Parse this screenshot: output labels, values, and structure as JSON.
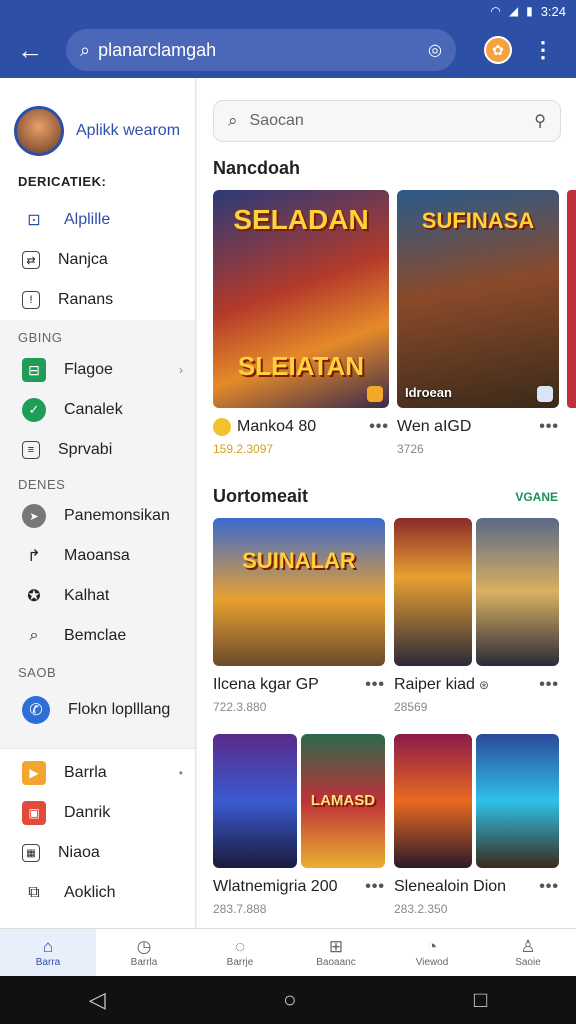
{
  "status_bar": {
    "time": "3:24",
    "wifi_icon": "wifi-icon",
    "signal_icon": "signal-icon",
    "battery_icon": "battery-icon"
  },
  "app_bar": {
    "search_text": "planarclamgah",
    "back_icon": "back-arrow-icon",
    "lens_icon": "lens-icon",
    "more_icon": "more-vert-icon"
  },
  "sidebar": {
    "profile_name": "Aplikk wearom",
    "section1": "DERICATIEK:",
    "items1": [
      {
        "label": "Alplille",
        "icon": "bag-icon"
      },
      {
        "label": "Nanjca",
        "icon": "doc-icon"
      },
      {
        "label": "Ranans",
        "icon": "info-icon"
      }
    ],
    "section2": "GBING",
    "items2": [
      {
        "label": "Flagoe",
        "icon": "grid-icon"
      },
      {
        "label": "Canalek",
        "icon": "compass-icon"
      },
      {
        "label": "Sprvabi",
        "icon": "list-icon"
      }
    ],
    "section3": "DENES",
    "items3": [
      {
        "label": "Panemonsikan",
        "icon": "send-icon"
      },
      {
        "label": "Maoansa",
        "icon": "share-icon"
      },
      {
        "label": "Kalhat",
        "icon": "badge-icon"
      },
      {
        "label": "Bemclae",
        "icon": "search-icon"
      }
    ],
    "section4": "SAOB",
    "special_item": {
      "label": "Flokn loplllang",
      "icon": "blue-circle-icon"
    },
    "items5": [
      {
        "label": "Barrla",
        "icon": "play-store-icon"
      },
      {
        "label": "Danrik",
        "icon": "gift-icon"
      },
      {
        "label": "Niaoa",
        "icon": "calc-icon"
      },
      {
        "label": "Aoklich",
        "icon": "open-icon"
      }
    ]
  },
  "content": {
    "search_placeholder": "Saocan",
    "section_a": "Nancdoah",
    "section_b": "Uortomeait",
    "section_b_link": "VGANE",
    "featured": [
      {
        "art_title": "SELADAN",
        "art_subtitle": "SLEIATAN",
        "name": "Manko4 80",
        "sub": "159.2.3097"
      },
      {
        "art_title": "SUFINASA",
        "art_caption": "Idroean",
        "name": "Wen aIGD",
        "sub": "3726"
      }
    ],
    "grid": [
      {
        "art_title": "SUINALAR",
        "name": "Ilcena kgar GP",
        "sub": "722.3.880"
      },
      {
        "name": "Raiper kiad",
        "sub": "28569"
      },
      {
        "art_title": "LAMASD",
        "name": "Wlatnemigria 200",
        "sub": "283.7.888"
      },
      {
        "name": "Slenealoin Dion",
        "sub": "283.2.350"
      }
    ],
    "more_label": "•••"
  },
  "bottom_nav": [
    {
      "label": "Barra",
      "icon": "home-icon"
    },
    {
      "label": "Barrla",
      "icon": "clock-icon"
    },
    {
      "label": "Barrje",
      "icon": "chat-icon"
    },
    {
      "label": "Baoaanc",
      "icon": "apps-icon"
    },
    {
      "label": "Viewod",
      "icon": "timer-icon"
    },
    {
      "label": "Saoie",
      "icon": "person-icon"
    }
  ]
}
